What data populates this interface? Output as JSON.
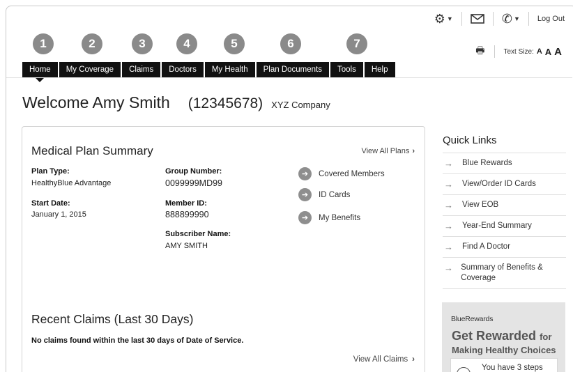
{
  "utility": {
    "settings_icon": "gear-icon",
    "mail_icon": "envelope-icon",
    "phone_icon": "phone-icon",
    "logout_label": "Log Out"
  },
  "text_size": {
    "label": "Text Size:",
    "small": "A",
    "medium": "A",
    "large": "A"
  },
  "steps": [
    "1",
    "2",
    "3",
    "4",
    "5",
    "6",
    "7"
  ],
  "nav": {
    "tabs": [
      {
        "label": "Home",
        "active": true
      },
      {
        "label": "My Coverage"
      },
      {
        "label": "Claims"
      },
      {
        "label": "Doctors"
      },
      {
        "label": "My Health"
      },
      {
        "label": "Plan Documents"
      },
      {
        "label": "Tools"
      },
      {
        "label": "Help"
      }
    ]
  },
  "welcome": {
    "greeting": "Welcome Amy Smith",
    "member_id": "(12345678)",
    "company": "XYZ Company"
  },
  "plan_summary": {
    "title": "Medical Plan Summary",
    "view_all_label": "View All Plans",
    "plan_type_label": "Plan Type:",
    "plan_type_value": "HealthyBlue Advantage",
    "start_date_label": "Start Date:",
    "start_date_value": "January 1, 2015",
    "group_number_label": "Group Number:",
    "group_number_value": "0099999MD99",
    "member_id_label": "Member ID:",
    "member_id_value": "888899990",
    "subscriber_label": "Subscriber Name:",
    "subscriber_value": "AMY SMITH",
    "links": [
      "Covered Members",
      "ID Cards",
      "My Benefits"
    ]
  },
  "claims": {
    "title": "Recent Claims (Last 30 Days)",
    "message": "No claims found within the last 30 days of Date of Service.",
    "view_all_label": "View All Claims"
  },
  "quick_links": {
    "title": "Quick Links",
    "items": [
      "Blue Rewards",
      "View/Order ID Cards",
      "View EOB",
      "Year-End Summary",
      "Find A Doctor",
      "Summary of Benefits & Coverage"
    ]
  },
  "rewards": {
    "brand": "BlueRewards",
    "headline": "Get Rewarded",
    "headline_for": "for",
    "subheadline": "Making Healthy Choices",
    "steps_text": "You have 3 steps"
  }
}
